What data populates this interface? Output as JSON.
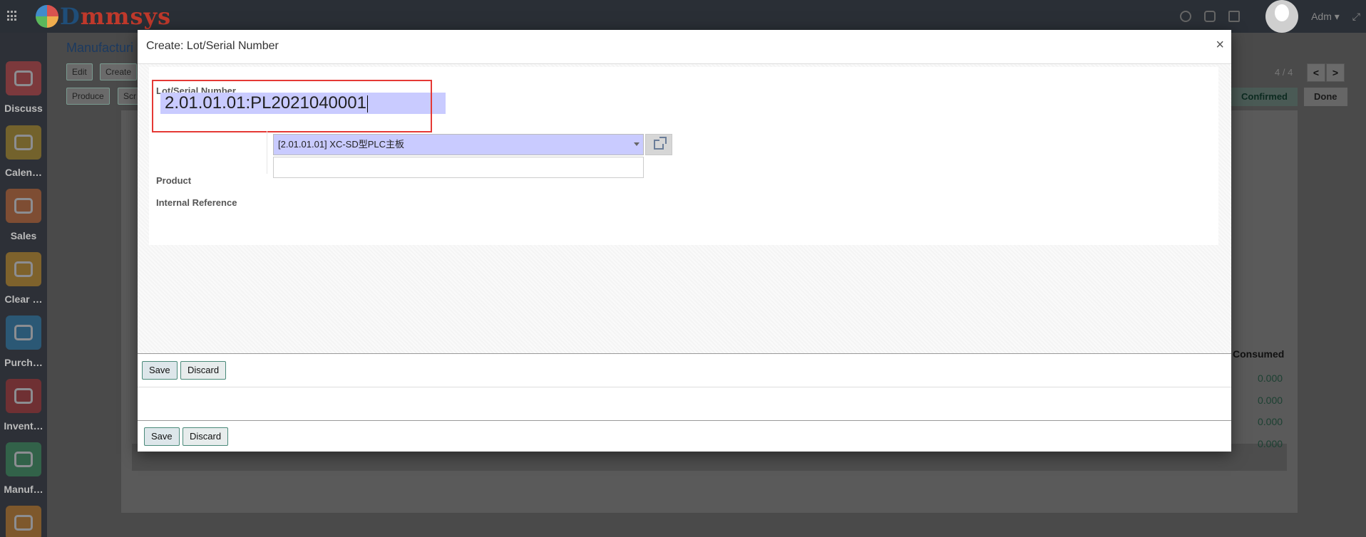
{
  "topbar": {
    "brand_d": "D",
    "brand_rest": "mmsys",
    "user_name": "Adm ▾",
    "expand_glyph": "⤢"
  },
  "sidebar": {
    "items": [
      {
        "label": "Discuss",
        "color": "#d44"
      },
      {
        "label": "Calen…",
        "color": "#c8a020"
      },
      {
        "label": "Sales",
        "color": "#e07030"
      },
      {
        "label": "Clear …",
        "color": "#e0a020"
      },
      {
        "label": "Purch…",
        "color": "#2a8ac0"
      },
      {
        "label": "Invent…",
        "color": "#c03030"
      },
      {
        "label": "Manuf…",
        "color": "#3aa060"
      },
      {
        "label": "",
        "color": "#e08a20"
      }
    ]
  },
  "background": {
    "title": "Manufacturi",
    "edit": "Edit",
    "create": "Create",
    "produce": "Produce",
    "scrap": "Scr",
    "pager": "4 / 4",
    "prev": "<",
    "next": ">",
    "status_confirmed": "Confirmed",
    "status_done": "Done",
    "col_consumed": "Consumed",
    "consumed_values": [
      "0.000",
      "0.000",
      "0.000",
      "0.000"
    ]
  },
  "modal": {
    "title": "Create: Lot/Serial Number",
    "close": "×",
    "lot_label": "Lot/Serial Number",
    "lot_value": "2.01.01.01:PL2021040001",
    "product_label": "Product",
    "product_value": "[2.01.01.01] XC-SD型PLC主板",
    "internal_ref_label": "Internal Reference",
    "internal_ref_value": "",
    "save": "Save",
    "discard": "Discard"
  }
}
